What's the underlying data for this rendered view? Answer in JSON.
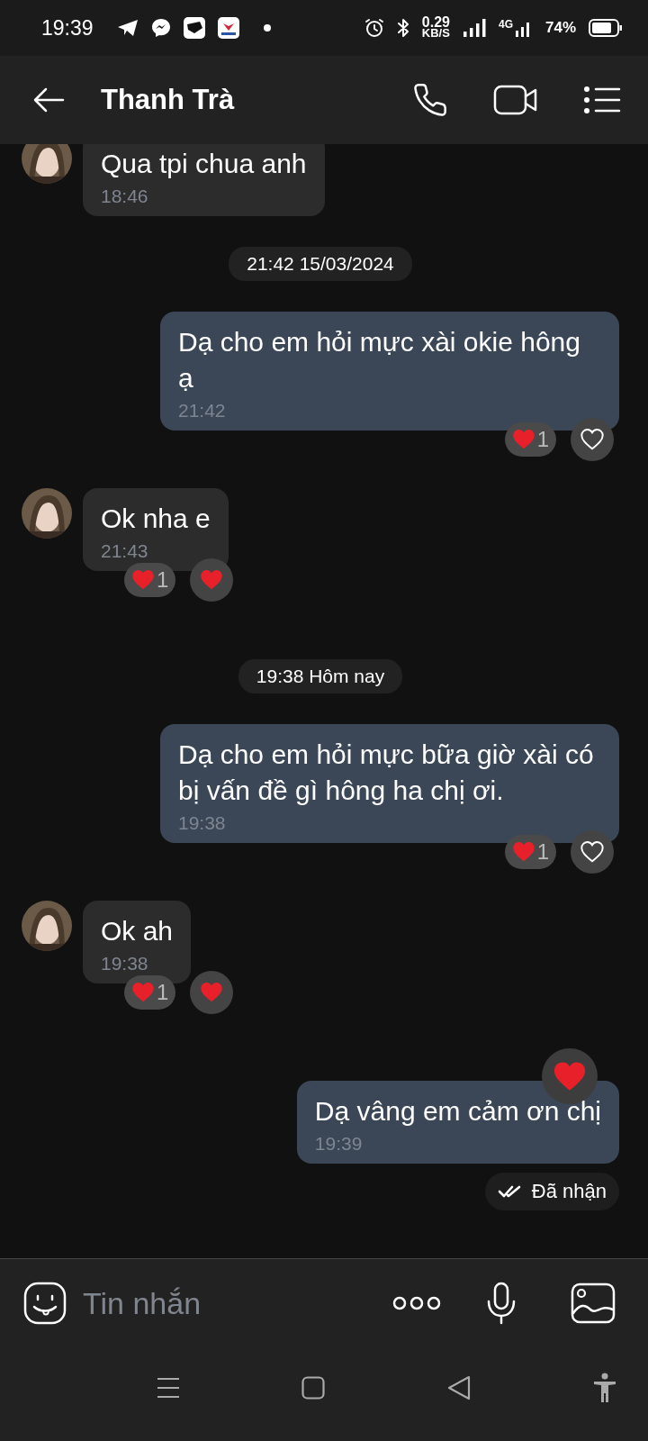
{
  "status_bar": {
    "time": "19:39",
    "speed": "0.29",
    "speed_unit": "KB/S",
    "network": "4G",
    "battery": "74%"
  },
  "contact": {
    "name": "Thanh Trà"
  },
  "messages": [
    {
      "kind": "incoming",
      "text": "Qua tpi chua anh",
      "time": "18:46"
    },
    {
      "kind": "date",
      "text": "21:42 15/03/2024"
    },
    {
      "kind": "outgoing",
      "text": "Dạ cho em hỏi mực xài okie hông ạ",
      "time": "21:42",
      "reaction_count": "1",
      "liked": false
    },
    {
      "kind": "incoming",
      "text": "Ok nha e",
      "time": "21:43",
      "reaction_count": "1",
      "liked": true
    },
    {
      "kind": "date",
      "text": "19:38 Hôm nay"
    },
    {
      "kind": "outgoing",
      "text": "Dạ cho em hỏi mực bữa giờ xài có bị vấn đề gì hông ha chị ơi.",
      "time": "19:38",
      "reaction_count": "1",
      "liked": false
    },
    {
      "kind": "incoming",
      "text": "Ok ah",
      "time": "19:38",
      "reaction_count": "1",
      "liked": true
    },
    {
      "kind": "outgoing",
      "text": "Dạ vâng em cảm ơn chị",
      "time": "19:39",
      "liked": true,
      "status": "Đã nhận"
    }
  ],
  "composer": {
    "placeholder": "Tin nhắn"
  }
}
